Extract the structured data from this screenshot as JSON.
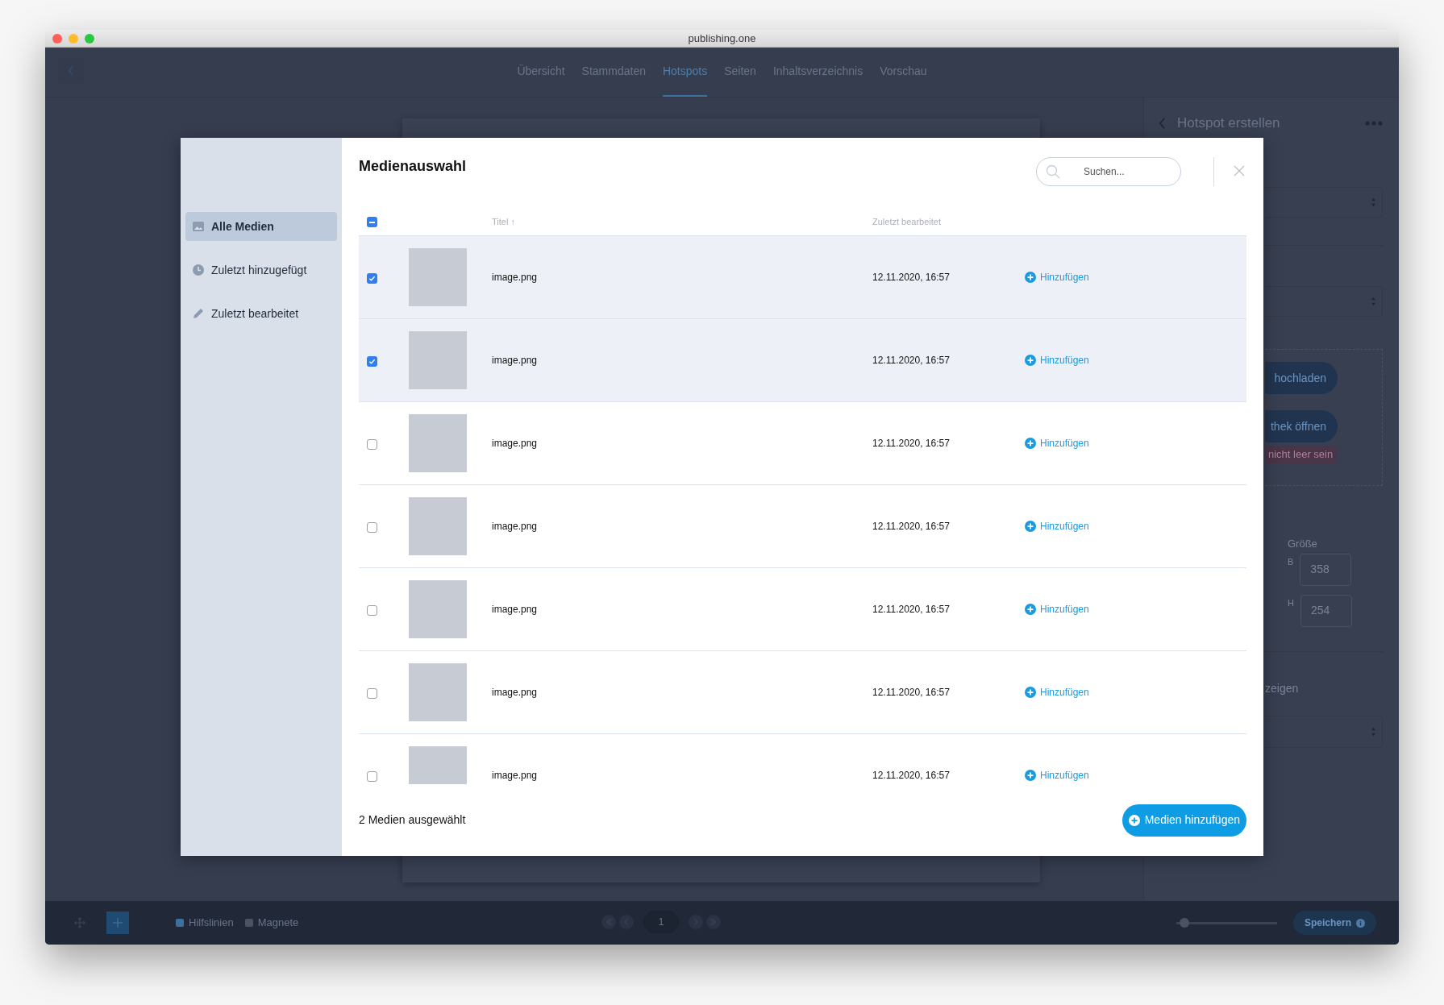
{
  "window": {
    "title": "publishing.one"
  },
  "nav": {
    "tabs": [
      {
        "label": "Übersicht",
        "selected": false
      },
      {
        "label": "Stammdaten",
        "selected": false
      },
      {
        "label": "Hotspots",
        "selected": true
      },
      {
        "label": "Seiten",
        "selected": false
      },
      {
        "label": "Inhaltsverzeichnis",
        "selected": false
      },
      {
        "label": "Vorschau",
        "selected": false
      }
    ]
  },
  "side_panel": {
    "title": "Hotspot erstellen",
    "upload_button": "hochladen",
    "library_button": "thek öffnen",
    "error_tag": "nicht leer sein",
    "size_label": "Größe",
    "width_label": "B",
    "width_value": "358",
    "height_label": "H",
    "height_value": "254",
    "display_label": "zeigen"
  },
  "bottom_bar": {
    "guides": {
      "label": "Hilfslinien",
      "checked": true
    },
    "magnets": {
      "label": "Magnete",
      "checked": false
    },
    "page": "1",
    "slider": {
      "level": 0.04
    },
    "save_button": "Speichern"
  },
  "modal": {
    "title": "Medienauswahl",
    "search": {
      "placeholder": "Suchen..."
    },
    "sidebar": [
      {
        "label": "Alle Medien",
        "selected": true
      },
      {
        "label": "Zuletzt hinzugefügt",
        "selected": false
      },
      {
        "label": "Zuletzt bearbeitet",
        "selected": false
      }
    ],
    "table": {
      "select_all": {
        "checked": true,
        "indeterminate": true
      },
      "columns": [
        "Titel ↑",
        "Zuletzt bearbeitet"
      ],
      "rows": [
        {
          "title": "image.png",
          "edited": "12.11.2020, 16:57",
          "action": "Hinzufügen",
          "selected": true
        },
        {
          "title": "image.png",
          "edited": "12.11.2020, 16:57",
          "action": "Hinzufügen",
          "selected": true
        },
        {
          "title": "image.png",
          "edited": "12.11.2020, 16:57",
          "action": "Hinzufügen",
          "selected": false
        },
        {
          "title": "image.png",
          "edited": "12.11.2020, 16:57",
          "action": "Hinzufügen",
          "selected": false
        },
        {
          "title": "image.png",
          "edited": "12.11.2020, 16:57",
          "action": "Hinzufügen",
          "selected": false
        },
        {
          "title": "image.png",
          "edited": "12.11.2020, 16:57",
          "action": "Hinzufügen",
          "selected": false
        },
        {
          "title": "image.png",
          "edited": "12.11.2020, 16:57",
          "action": "Hinzufügen",
          "selected": false
        }
      ]
    },
    "footer": {
      "status": "2 Medien ausgewählt",
      "button": "Medien hinzufügen"
    }
  }
}
